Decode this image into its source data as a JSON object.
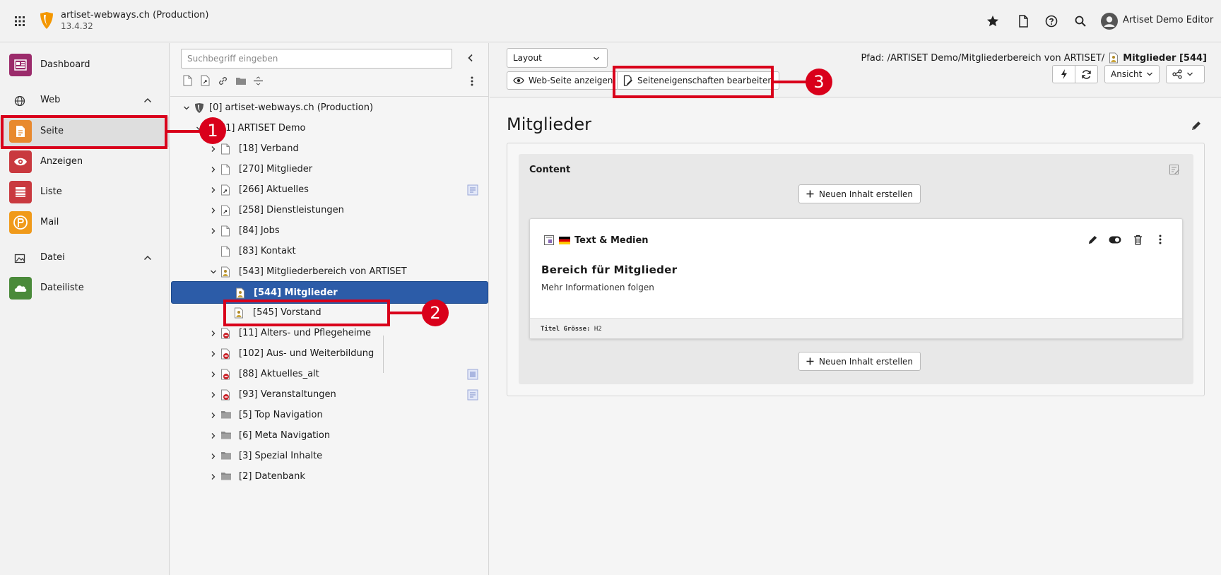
{
  "header": {
    "site_name": "artiset-webways.ch (Production)",
    "site_version": "13.4.32",
    "user_name": "Artiset Demo Editor"
  },
  "sidebar": {
    "dashboard": "Dashboard",
    "group_web": "Web",
    "seite": "Seite",
    "anzeigen": "Anzeigen",
    "liste": "Liste",
    "mail": "Mail",
    "group_datei": "Datei",
    "dateiliste": "Dateiliste"
  },
  "tree": {
    "search_placeholder": "Suchbegriff eingeben",
    "nodes": [
      "[0] artiset-webways.ch (Production)",
      "[1] ARTISET Demo",
      "[18] Verband",
      "[270] Mitglieder",
      "[266] Aktuelles",
      "[258] Dienstleistungen",
      "[84] Jobs",
      "[83] Kontakt",
      "[543] Mitgliederbereich von ARTISET",
      "[544] Mitglieder",
      "[545] Vorstand",
      "[11] Alters- und Pflegeheime",
      "[102] Aus- und Weiterbildung",
      "[88] Aktuelles_alt",
      "[93] Veranstaltungen",
      "[5] Top Navigation",
      "[6] Meta Navigation",
      "[3] Spezial Inhalte",
      "[2] Datenbank"
    ]
  },
  "docheader": {
    "layout_select": "Layout",
    "view_button": "Web-Seite anzeigen",
    "edit_props_button": "Seiteneigenschaften bearbeiten",
    "path_prefix": "Pfad: /ARTISET Demo/Mitgliederbereich von ARTISET/",
    "path_current": "Mitglieder [544]",
    "ansicht": "Ansicht"
  },
  "main": {
    "page_title": "Mitglieder",
    "column_title": "Content",
    "new_content": "Neuen Inhalt erstellen",
    "card": {
      "type": "Text & Medien",
      "headline": "Bereich für Mitglieder",
      "text": "Mehr Informationen folgen",
      "footer_key": "Titel Grösse:",
      "footer_value": "H2"
    }
  },
  "annotations": {
    "marker1": "1",
    "marker2": "2",
    "marker3": "3",
    "color": "#d9001b"
  },
  "colors": {
    "selected_node": "#2c5ca8",
    "seite_icon": "#e8892e",
    "dashboard_icon": "#9b2b6b",
    "anzeigen_icon": "#c9393f",
    "liste_icon": "#c9393f",
    "mail_icon": "#f09a1a",
    "dateiliste_icon": "#4a8a3a"
  }
}
